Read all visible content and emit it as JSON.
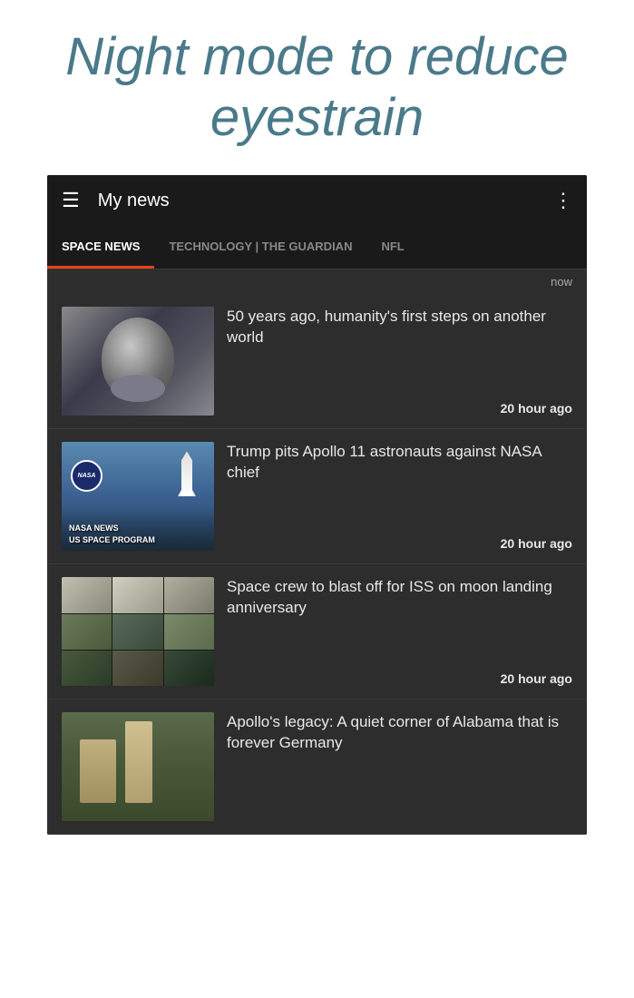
{
  "promo": {
    "title": "Night mode to reduce eyestrain"
  },
  "header": {
    "menu_label": "☰",
    "title": "My news",
    "more_label": "⋮"
  },
  "tabs": [
    {
      "id": "space-news",
      "label": "SPACE NEWS",
      "active": true
    },
    {
      "id": "technology",
      "label": "TECHNOLOGY | THE GUARDIAN",
      "active": false
    },
    {
      "id": "nfl",
      "label": "NFL",
      "active": false
    }
  ],
  "timestamp_bar": {
    "label": "now"
  },
  "news_items": [
    {
      "id": "news-1",
      "headline": "50 years ago, humanity's first steps on another world",
      "time": "20 hour ago",
      "thumb_type": "astronaut"
    },
    {
      "id": "news-2",
      "headline": "Trump pits Apollo 11 astronauts against NASA chief",
      "time": "20 hour ago",
      "thumb_type": "nasa",
      "nasa_line1": "NASA NEWS",
      "nasa_line2": "US SPACE PROGRAM"
    },
    {
      "id": "news-3",
      "headline": "Space crew to blast off for ISS on moon landing anniversary",
      "time": "20 hour ago",
      "thumb_type": "crew"
    },
    {
      "id": "news-4",
      "headline": "Apollo's legacy: A quiet corner of Alabama that is forever Germany",
      "time": "",
      "thumb_type": "apollo"
    }
  ],
  "colors": {
    "accent": "#e8411a",
    "background_dark": "#2d2d2d",
    "topbar": "#1a1a1a",
    "text_light": "#e8e8e8",
    "text_muted": "#aaaaaa",
    "active_tab_text": "#ffffff"
  }
}
